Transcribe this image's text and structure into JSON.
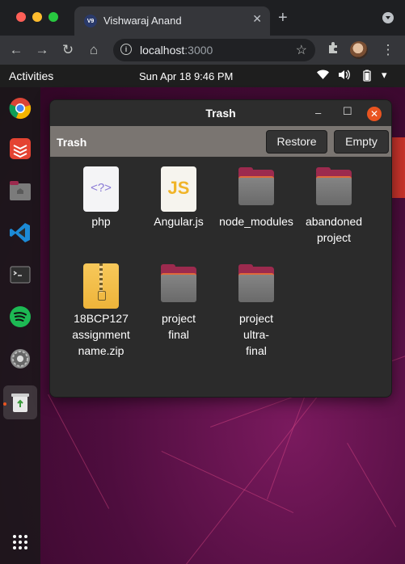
{
  "browser": {
    "tab_title": "Vishwaraj Anand",
    "tab_favicon_text": "V9",
    "address_host": "localhost",
    "address_port": ":3000",
    "colors": {
      "tab_bg": "#35363a",
      "chrome_bg": "#1e1f22"
    }
  },
  "ubuntu_topbar": {
    "activities": "Activities",
    "clock": "Sun Apr 18  9:46 PM"
  },
  "dock": {
    "items": [
      "chrome-icon",
      "todoist-icon",
      "home-folder-icon",
      "vscode-icon",
      "terminal-icon",
      "spotify-icon",
      "settings-icon",
      "trash-icon",
      "app-grid-icon"
    ],
    "active_item": "trash-icon"
  },
  "trash_window": {
    "title": "Trash",
    "location_label": "Trash",
    "restore_label": "Restore",
    "empty_label": "Empty",
    "items": [
      {
        "icon": "php-file-icon",
        "line1": "php",
        "line2": "",
        "line3": ""
      },
      {
        "icon": "js-file-icon",
        "line1": "Angular.js",
        "line2": "",
        "line3": ""
      },
      {
        "icon": "folder-icon",
        "line1": "node_modules",
        "line2": "",
        "line3": ""
      },
      {
        "icon": "folder-icon",
        "line1": "abandoned",
        "line2": "project",
        "line3": ""
      },
      {
        "icon": "zip-file-icon",
        "line1": "18BCP127",
        "line2": "assignment",
        "line3": "name.zip"
      },
      {
        "icon": "folder-icon",
        "line1": "project",
        "line2": "final",
        "line3": ""
      },
      {
        "icon": "folder-icon",
        "line1": "project",
        "line2": "ultra-",
        "line3": "final"
      }
    ],
    "colors": {
      "accent": "#e95420",
      "toolbar": "#7a7571",
      "window_bg": "#2b2b2b"
    }
  }
}
